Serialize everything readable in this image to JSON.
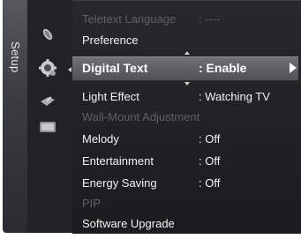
{
  "side_tab": {
    "label": "Setup"
  },
  "side_icons": [
    "antenna-icon",
    "settings-gear-icon",
    "satellite-icon",
    "input-icon"
  ],
  "menu": {
    "items": [
      {
        "label": "Teletext Language",
        "value": ": ----",
        "state": "disabled"
      },
      {
        "label": "Preference",
        "value": "",
        "state": "enabled"
      },
      {
        "label": "Digital Text",
        "value": ": Enable",
        "state": "selected"
      },
      {
        "label": "Light Effect",
        "value": ": Watching TV",
        "state": "enabled"
      },
      {
        "label": "Wall-Mount Adjustment",
        "value": "",
        "state": "disabled"
      },
      {
        "label": "Melody",
        "value": ": Off",
        "state": "enabled"
      },
      {
        "label": "Entertainment",
        "value": ": Off",
        "state": "enabled"
      },
      {
        "label": "Energy Saving",
        "value": ": Off",
        "state": "enabled"
      },
      {
        "label": "PIP",
        "value": "",
        "state": "disabled"
      },
      {
        "label": "Software Upgrade",
        "value": "",
        "state": "enabled"
      }
    ]
  },
  "colors": {
    "highlight": "#5e6166",
    "disabled_text": "#5e6065",
    "text": "#f2f2f2"
  }
}
